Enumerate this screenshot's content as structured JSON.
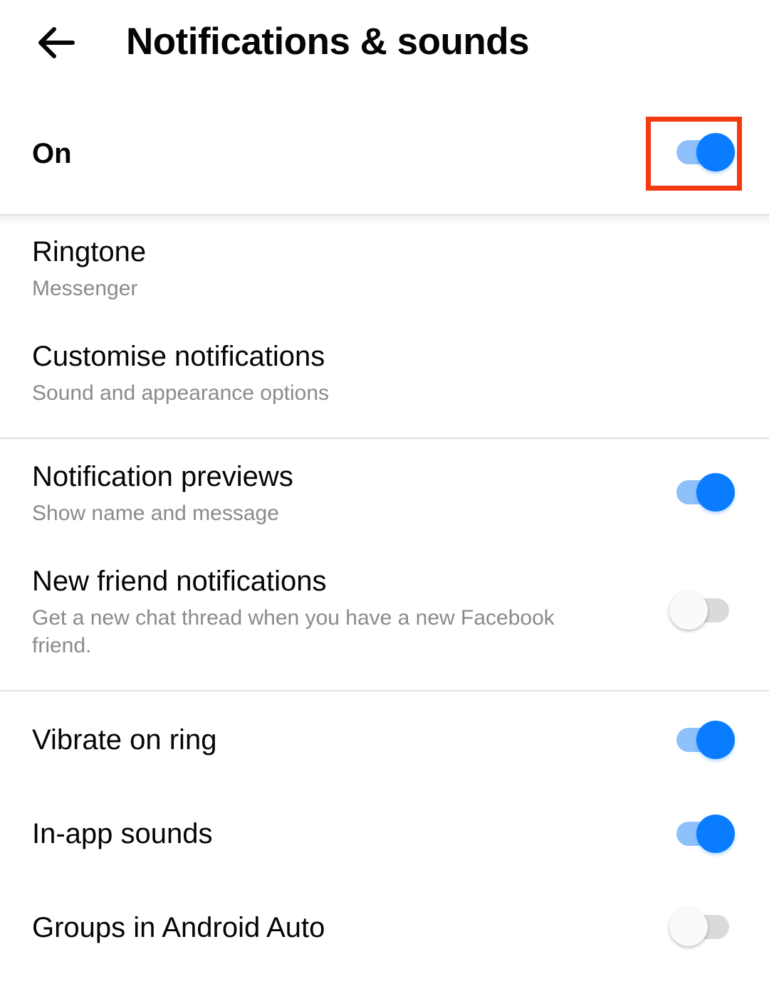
{
  "header": {
    "back_icon": "arrow-left-icon",
    "title": "Notifications & sounds"
  },
  "master_toggle": {
    "label": "On",
    "checked": true,
    "highlighted": true,
    "highlight_color": "#f2390f"
  },
  "sections": [
    {
      "items": [
        {
          "title": "Ringtone",
          "subtitle": "Messenger"
        },
        {
          "title": "Customise notifications",
          "subtitle": "Sound and appearance options"
        }
      ]
    },
    {
      "items": [
        {
          "title": "Notification previews",
          "subtitle": "Show name and message",
          "checked": true
        },
        {
          "title": "New friend notifications",
          "subtitle": "Get a new chat thread when you have a new Facebook friend.",
          "checked": false
        }
      ]
    },
    {
      "items": [
        {
          "title": "Vibrate on ring",
          "checked": true
        },
        {
          "title": "In-app sounds",
          "checked": true
        },
        {
          "title": "Groups in Android Auto",
          "checked": false
        }
      ]
    }
  ],
  "colors": {
    "accent": "#0a7cff",
    "accent_track": "#8ec0fb",
    "off_track": "#dadada",
    "off_thumb": "#fafafa",
    "subtitle": "#8a8a8a"
  }
}
